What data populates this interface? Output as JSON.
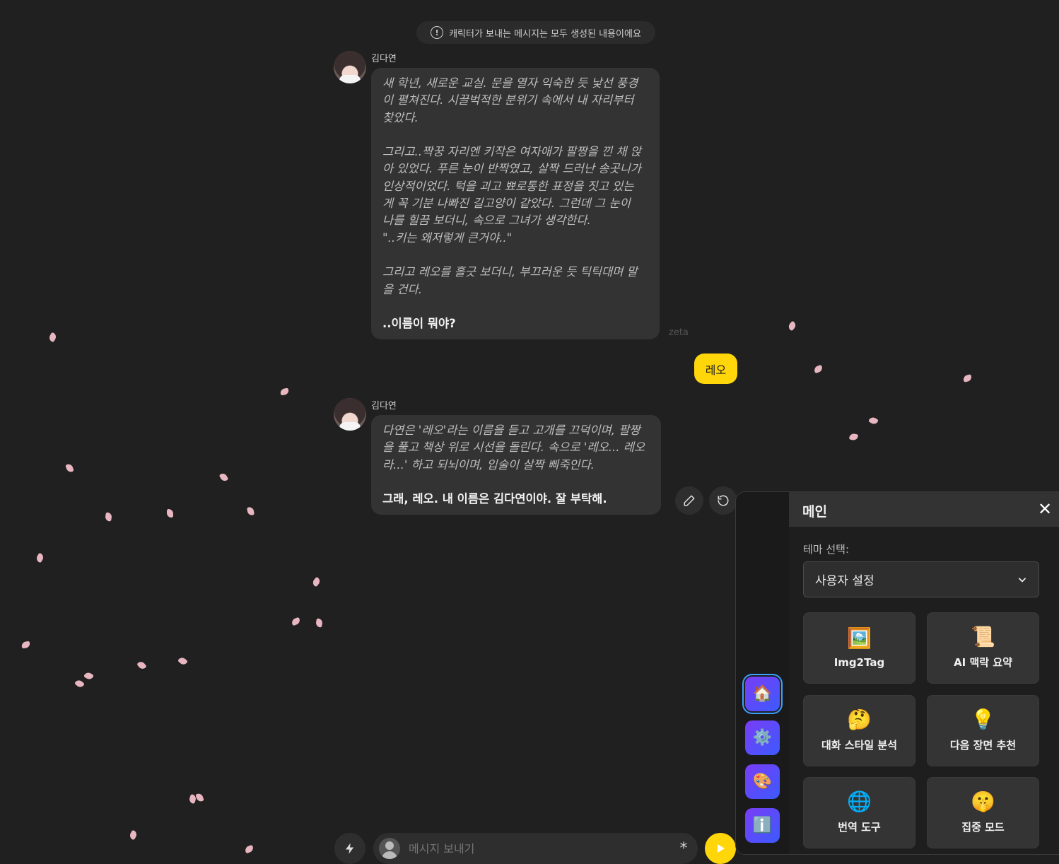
{
  "notice": {
    "text": "캐릭터가 보내는 메시지는 모두 생성된 내용이에요",
    "icon": "exclamation-circle-icon"
  },
  "messages": [
    {
      "sender": "김다연",
      "italic": "새 학년, 새로운 교실. 문을 열자 익숙한 듯 낯선 풍경\n이 펼쳐진다. 시끌벅적한 분위기 속에서 내 자리부터\n찾았다.\n\n그리고..짝꿍 자리엔 키작은 여자애가 팔짱을 낀 채 앉\n아 있었다. 푸른 눈이 반짝였고, 살짝 드러난 송곳니가\n인상적이었다. 턱을 괴고 뾰로통한 표정을 짓고 있는\n게 꼭 기분 나빠진 길고양이 같았다. 그런데 그 눈이\n나를 힐끔 보더니, 속으로 그녀가 생각한다.\n\"..키는 왜저렇게 큰거야..\"\n\n그리고 레오를 흘긋 보더니, 부끄러운 듯 틱틱대며 말\n을 건다.",
      "bold": "..이름이 뭐야?",
      "watermark": "zeta"
    },
    {
      "user_text": "레오"
    },
    {
      "sender": "김다연",
      "italic": "다연은 '레오'라는 이름을 듣고 고개를 끄덕이며, 팔짱\n을 풀고 책상 위로 시선을 돌린다. 속으로 '레오... 레오\n라...' 하고 되뇌이며, 입술이 살짝 삐죽인다.",
      "bold": "그래, 레오. 내 이름은 김다연이야. 잘 부탁해."
    }
  ],
  "message_actions": {
    "edit_icon": "pencil-icon",
    "regenerate_icon": "refresh-icon"
  },
  "composer": {
    "placeholder": "메시지 보내기",
    "star": "*",
    "bolt_icon": "lightning-icon",
    "send_icon": "play-icon"
  },
  "panel": {
    "title": "메인",
    "close": "✕",
    "theme_label": "테마 선택:",
    "theme_value": "사용자 설정",
    "rail": [
      {
        "icon": "home-icon",
        "glyph": "🏠",
        "active": true
      },
      {
        "icon": "gear-icon",
        "glyph": "⚙️",
        "active": false
      },
      {
        "icon": "palette-icon",
        "glyph": "🎨",
        "active": false
      },
      {
        "icon": "info-icon",
        "glyph": "ℹ️",
        "active": false
      }
    ],
    "tiles": [
      {
        "emoji": "🖼️",
        "label": "Img2Tag"
      },
      {
        "emoji": "📜",
        "label": "AI 맥락 요약"
      },
      {
        "emoji": "🤔",
        "label": "대화 스타일 분석"
      },
      {
        "emoji": "💡",
        "label": "다음 장면 추천"
      },
      {
        "emoji": "🌐",
        "label": "번역 도구"
      },
      {
        "emoji": "🤫",
        "label": "집중 모드"
      }
    ]
  },
  "colors": {
    "background": "#202020",
    "bubble": "#333333",
    "accent_yellow": "#ffd60a",
    "petal": "#e7b6c0"
  }
}
